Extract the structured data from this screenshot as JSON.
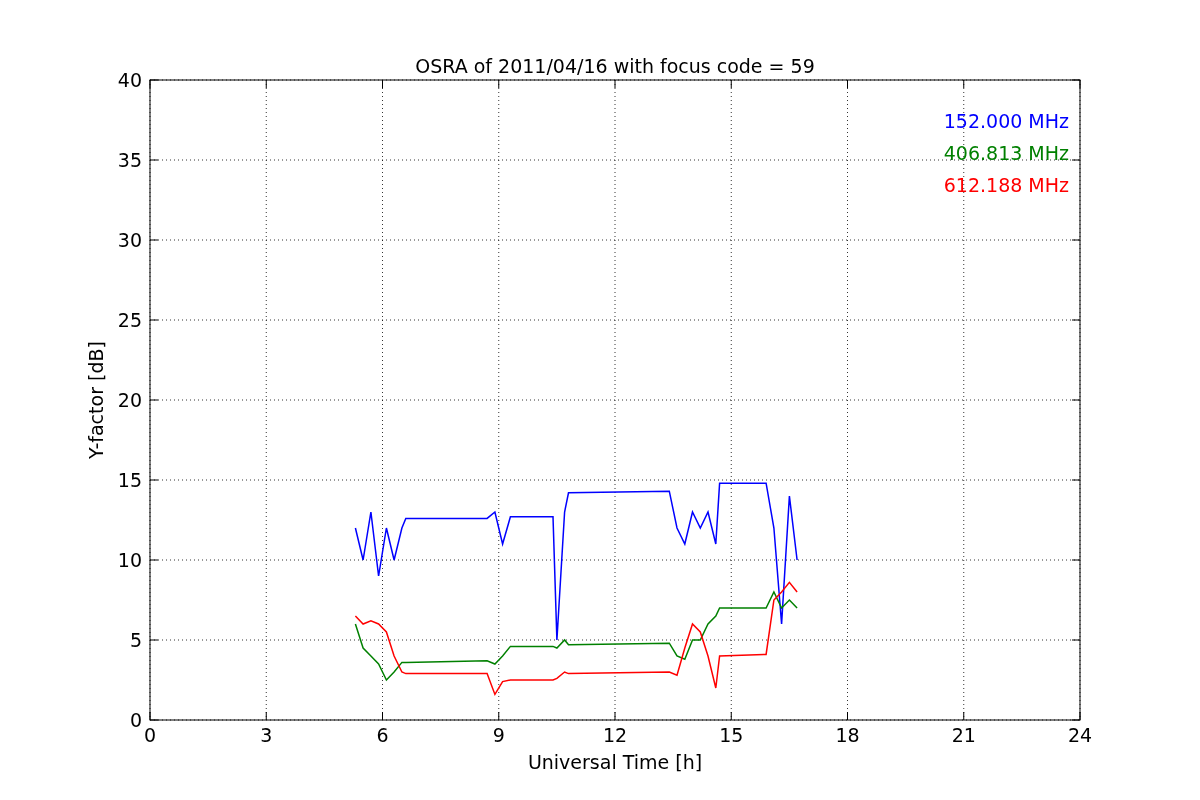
{
  "chart_data": {
    "type": "line",
    "title": "OSRA of 2011/04/16 with focus code = 59",
    "xlabel": "Universal Time [h]",
    "ylabel": "Y-factor [dB]",
    "x": [
      5.3,
      5.5,
      5.7,
      5.9,
      6.1,
      6.3,
      6.5,
      6.6,
      8.7,
      8.9,
      9.1,
      9.3,
      10.4,
      10.5,
      10.7,
      10.8,
      13.4,
      13.6,
      13.8,
      14.0,
      14.2,
      14.4,
      14.6,
      14.7,
      15.9,
      16.1,
      16.3,
      16.5,
      16.7
    ],
    "series": [
      {
        "name": "152.000 MHz",
        "color": "#0000ff",
        "values": [
          12,
          10,
          13,
          9,
          12,
          10,
          12,
          12.6,
          12.6,
          13,
          11,
          12.7,
          12.7,
          5,
          13,
          14.2,
          14.3,
          12,
          11,
          13,
          12,
          13,
          11,
          14.8,
          14.8,
          12,
          6,
          14,
          10
        ]
      },
      {
        "name": "406.813 MHz",
        "color": "#008000",
        "values": [
          6,
          4.5,
          4,
          3.5,
          2.5,
          3,
          3.6,
          3.6,
          3.7,
          3.5,
          4,
          4.6,
          4.6,
          4.5,
          5,
          4.7,
          4.8,
          4,
          3.8,
          5,
          5,
          6,
          6.5,
          7,
          7,
          8,
          7,
          7.5,
          7
        ]
      },
      {
        "name": "612.188 MHz",
        "color": "#ff0000",
        "values": [
          6.5,
          6,
          6.2,
          6,
          5.5,
          4,
          3,
          2.9,
          2.9,
          1.6,
          2.4,
          2.5,
          2.5,
          2.6,
          3,
          2.9,
          3,
          2.8,
          4.5,
          6,
          5.5,
          4,
          2,
          4,
          4.1,
          7.5,
          8,
          8.6,
          8
        ]
      }
    ],
    "xlim": [
      0,
      24
    ],
    "ylim": [
      0,
      40
    ],
    "xticks": [
      0,
      3,
      6,
      9,
      12,
      15,
      18,
      21,
      24
    ],
    "yticks": [
      0,
      5,
      10,
      15,
      20,
      25,
      30,
      35,
      40
    ],
    "grid": true
  }
}
